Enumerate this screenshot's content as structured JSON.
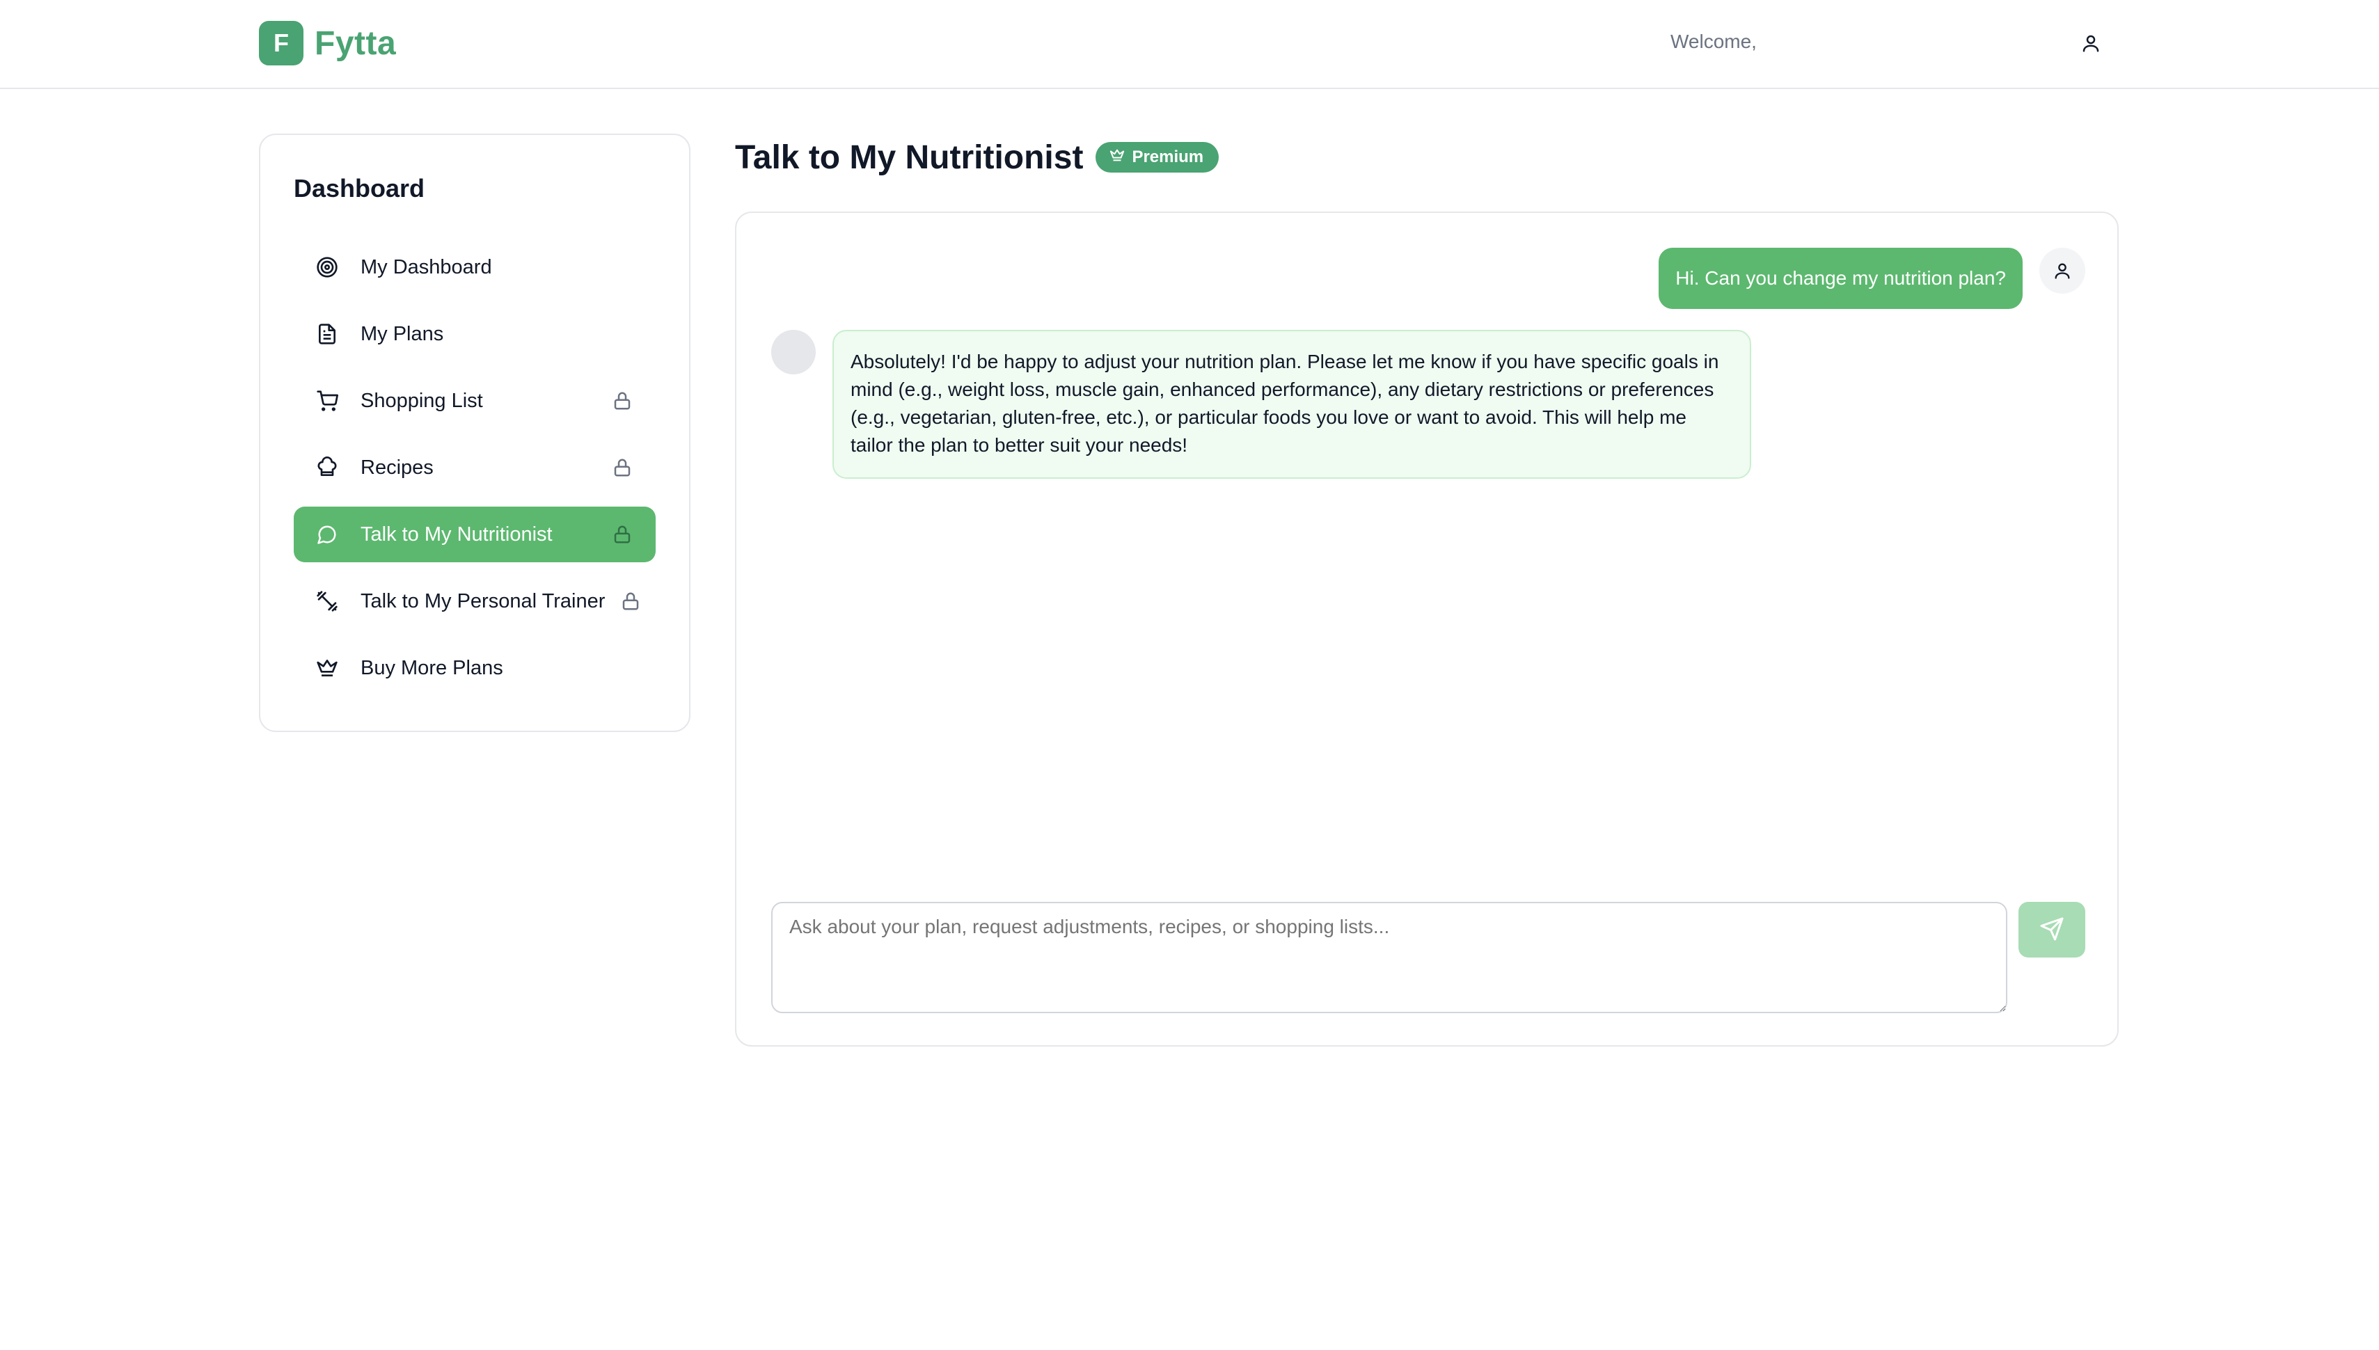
{
  "app": {
    "logo_letter": "F",
    "name": "Fytta",
    "brand_color": "#4aa372",
    "accent_color": "#5cb86f"
  },
  "header": {
    "welcome_text": "Welcome,",
    "user_icon": "user-icon"
  },
  "sidebar": {
    "title": "Dashboard",
    "items": [
      {
        "label": "My Dashboard",
        "icon": "target-icon",
        "locked": false,
        "active": false
      },
      {
        "label": "My Plans",
        "icon": "document-icon",
        "locked": false,
        "active": false
      },
      {
        "label": "Shopping List",
        "icon": "cart-icon",
        "locked": true,
        "active": false
      },
      {
        "label": "Recipes",
        "icon": "chef-hat-icon",
        "locked": true,
        "active": false
      },
      {
        "label": "Talk to My Nutritionist",
        "icon": "chat-bubble-icon",
        "locked": true,
        "active": true
      },
      {
        "label": "Talk to My Personal Trainer",
        "icon": "dumbbell-icon",
        "locked": true,
        "active": false
      },
      {
        "label": "Buy More Plans",
        "icon": "crown-icon",
        "locked": false,
        "active": false
      }
    ]
  },
  "main": {
    "title": "Talk to My Nutritionist",
    "badge": "Premium"
  },
  "chat": {
    "messages": [
      {
        "role": "user",
        "text": "Hi. Can you change my nutrition plan?"
      },
      {
        "role": "assistant",
        "text": "Absolutely! I'd be happy to adjust your nutrition plan. Please let me know if you have specific goals in mind (e.g., weight loss, muscle gain, enhanced performance), any dietary restrictions or preferences (e.g., vegetarian, gluten-free, etc.), or particular foods you love or want to avoid. This will help me tailor the plan to better suit your needs!"
      }
    ],
    "input_placeholder": "Ask about your plan, request adjustments, recipes, or shopping lists...",
    "input_value": ""
  }
}
